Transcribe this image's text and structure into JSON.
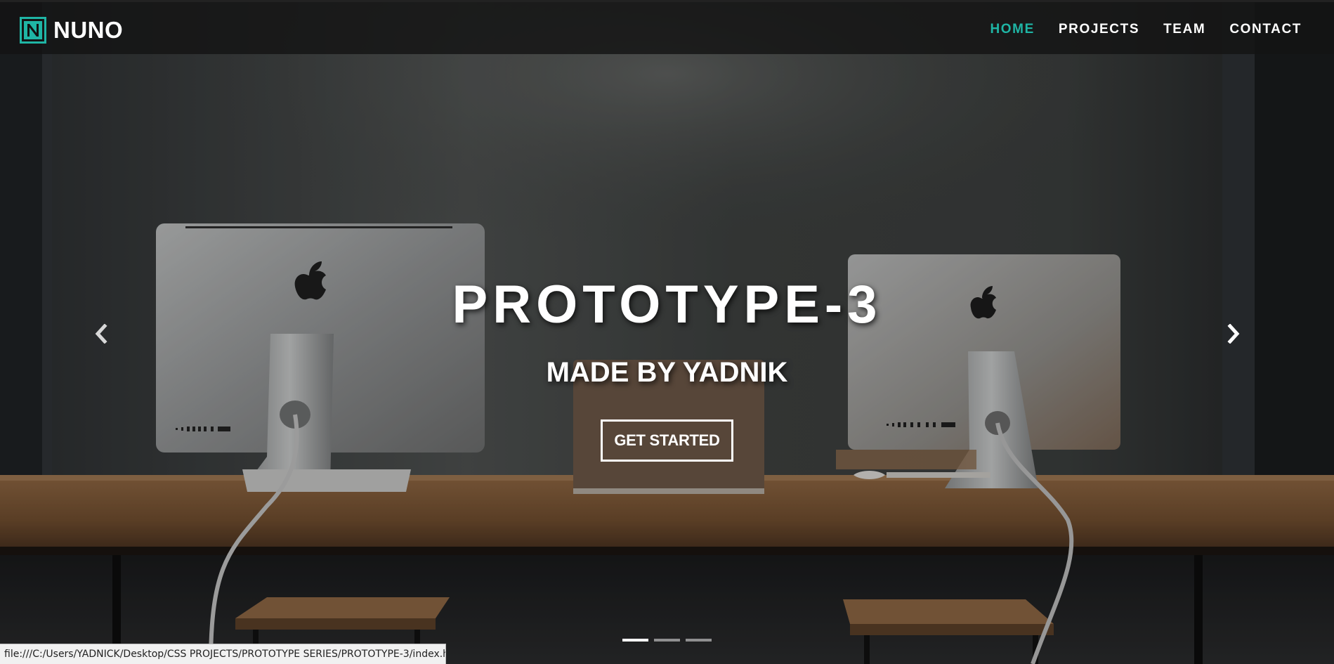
{
  "brand": {
    "name": "NUNO",
    "logo_letter": "N",
    "accent_color": "#1fb5a5"
  },
  "nav": {
    "items": [
      {
        "label": "HOME",
        "active": true
      },
      {
        "label": "PROJECTS",
        "active": false
      },
      {
        "label": "TEAM",
        "active": false
      },
      {
        "label": "CONTACT",
        "active": false
      }
    ]
  },
  "hero": {
    "title": "PROTOTYPE-3",
    "subtitle": "MADE BY YADNIK",
    "cta_label": "GET STARTED",
    "prev_icon": "chevron-left-icon",
    "next_icon": "chevron-right-icon",
    "slides_count": 3,
    "active_slide": 0,
    "background": "photo of two desktop computers and a laptop on a wooden table against a concrete wall"
  },
  "statusbar": {
    "url": "file:///C:/Users/YADNICK/Desktop/CSS PROJECTS/PROTOTYPE SERIES/PROTOTYPE-3/index.ht..."
  }
}
